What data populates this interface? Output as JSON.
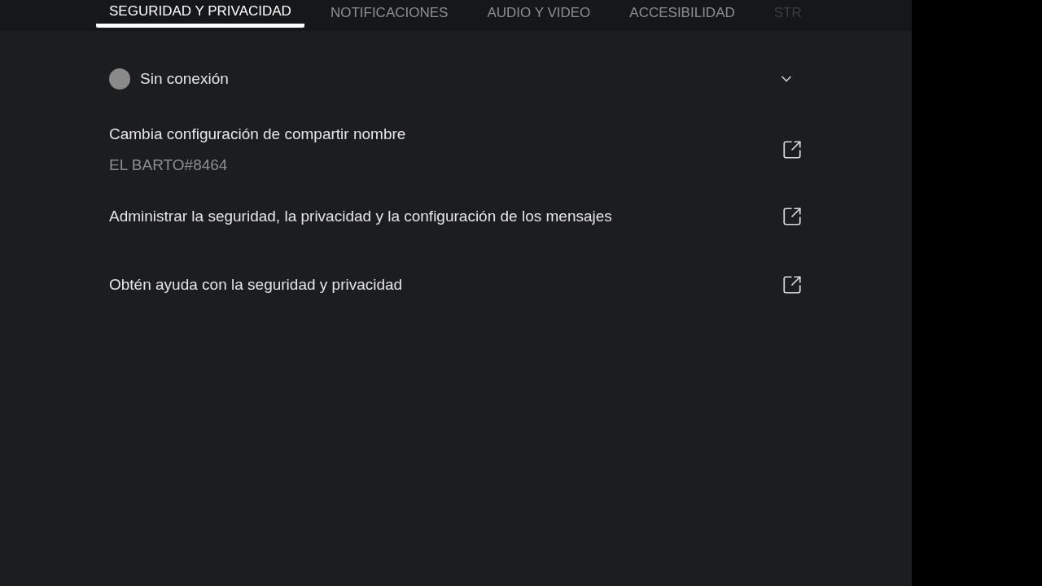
{
  "tabs": [
    {
      "label": "SEGURIDAD Y PRIVACIDAD",
      "selected": true
    },
    {
      "label": "NOTIFICACIONES",
      "selected": false
    },
    {
      "label": "AUDIO Y VIDEO",
      "selected": false
    },
    {
      "label": "ACCESIBILIDAD",
      "selected": false
    },
    {
      "label": "STR",
      "selected": false
    }
  ],
  "status": {
    "label": "Sin conexión",
    "color": "#8a8a8a",
    "expanded": false
  },
  "links": [
    {
      "title": "Cambia configuración de compartir nombre",
      "subtitle": "EL BARTO#8464"
    },
    {
      "title": "Administrar la seguridad, la privacidad y la configuración de los mensajes"
    },
    {
      "title": "Obtén ayuda con la seguridad y privacidad"
    }
  ]
}
